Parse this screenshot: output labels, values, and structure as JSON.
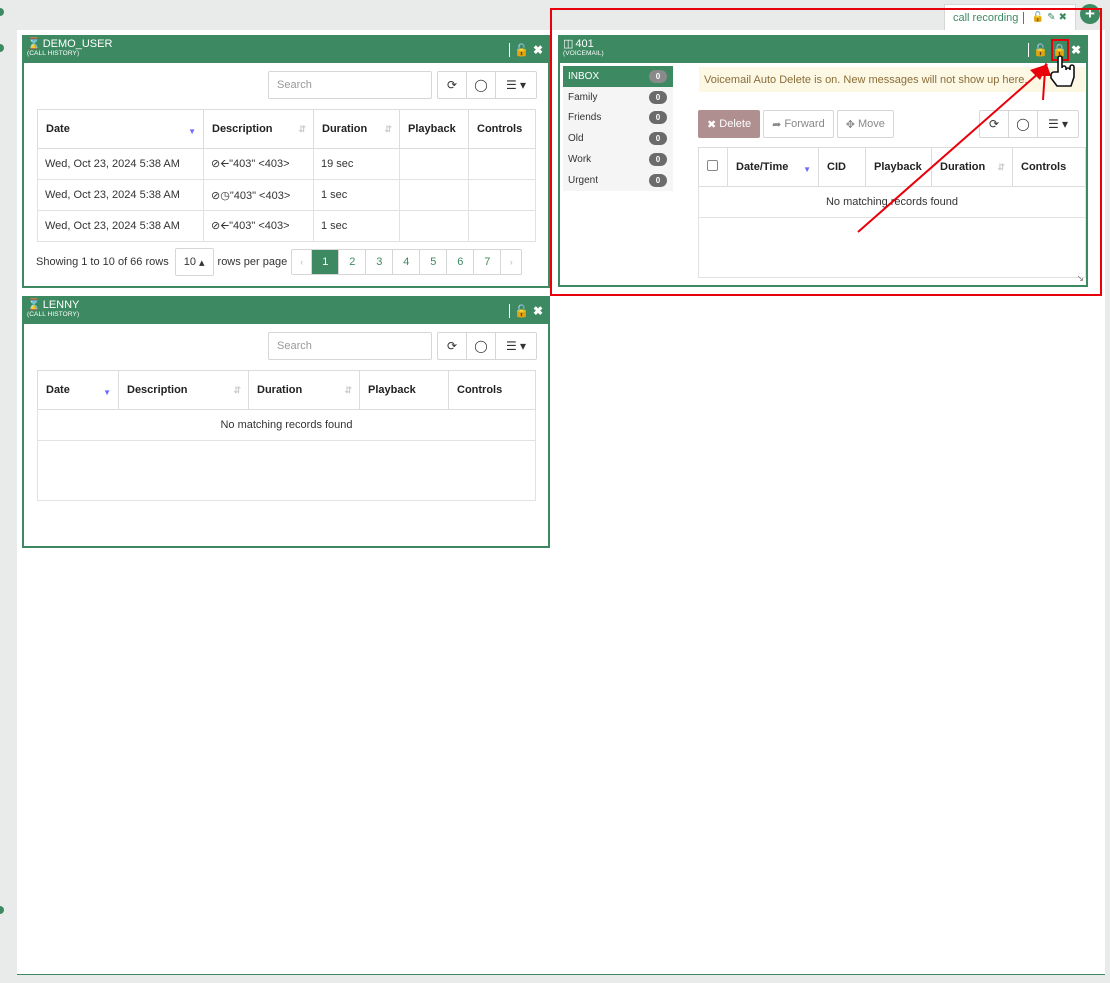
{
  "tabs": [
    {
      "label": "call recording"
    }
  ],
  "demo_widget": {
    "title": "DEMO_USER",
    "subtitle": "(CALL HISTORY)",
    "search_placeholder": "Search",
    "columns": [
      "Date",
      "Description",
      "Duration",
      "Playback",
      "Controls"
    ],
    "rows": [
      {
        "date": "Wed, Oct 23, 2024 5:38 AM",
        "desc": "\"403\" <403>",
        "duration": "19 sec",
        "icon": "arrow-left-icon"
      },
      {
        "date": "Wed, Oct 23, 2024 5:38 AM",
        "desc": "\"403\" <403>",
        "duration": "1 sec",
        "icon": "clock-icon"
      },
      {
        "date": "Wed, Oct 23, 2024 5:38 AM",
        "desc": "\"403\" <403>",
        "duration": "1 sec",
        "icon": "arrow-left-icon"
      }
    ],
    "pager": {
      "showing": "Showing 1 to 10 of 66 rows",
      "page_size": "10",
      "per_page": "rows per page",
      "pages": [
        "1",
        "2",
        "3",
        "4",
        "5",
        "6",
        "7"
      ],
      "prev": "‹",
      "next": "›"
    }
  },
  "lenny_widget": {
    "title": "LENNY",
    "subtitle": "(CALL HISTORY)",
    "search_placeholder": "Search",
    "columns": [
      "Date",
      "Description",
      "Duration",
      "Playback",
      "Controls"
    ],
    "empty": "No matching records found"
  },
  "voicemail_widget": {
    "title": "401",
    "subtitle": "(VOICEMAIL)",
    "folders": [
      {
        "name": "INBOX",
        "count": "0"
      },
      {
        "name": "Family",
        "count": "0"
      },
      {
        "name": "Friends",
        "count": "0"
      },
      {
        "name": "Old",
        "count": "0"
      },
      {
        "name": "Work",
        "count": "0"
      },
      {
        "name": "Urgent",
        "count": "0"
      }
    ],
    "notice": "Voicemail Auto Delete is on. New messages will not show up here.",
    "actions": {
      "delete": "Delete",
      "forward": "Forward",
      "move": "Move"
    },
    "columns": [
      "Date/Time",
      "CID",
      "Playback",
      "Duration",
      "Controls"
    ],
    "empty": "No matching records found"
  },
  "colors": {
    "brand_green": "#3d8a62",
    "annotation_red": "#e8000b",
    "notice_bg": "#fcf8e3"
  }
}
